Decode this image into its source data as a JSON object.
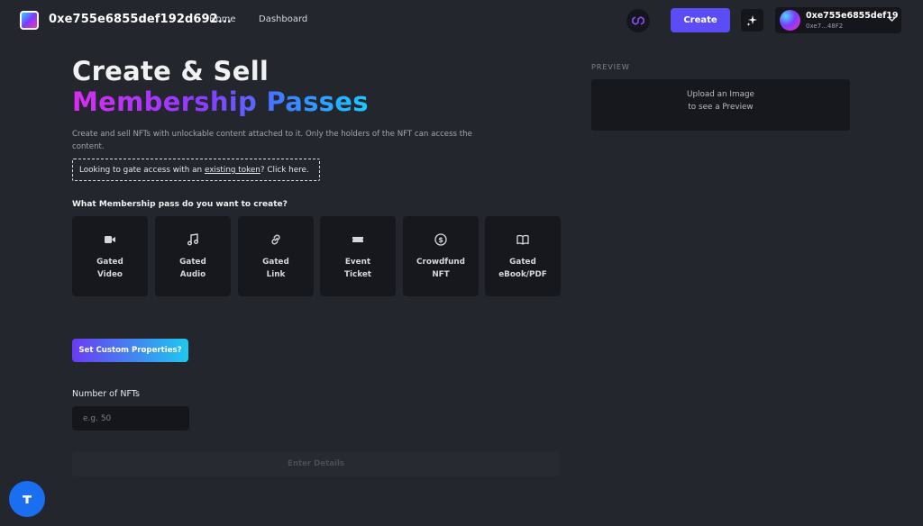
{
  "nav": {
    "brand": "0xe755e6855def192d692...",
    "links": [
      "Home",
      "Dashboard"
    ],
    "create_label": "Create",
    "account_name": "0xe755e6855def19",
    "account_short": "0xe7...48F2"
  },
  "hero": {
    "title_line1": "Create & Sell",
    "title_line2": "Membership Passes",
    "description": "Create and sell NFTs with unlockable content attached to it. Only the holders of the NFT can access the content.",
    "gate_prefix": "Looking to gate access with an ",
    "gate_link": "existing token",
    "gate_suffix": "? Click here."
  },
  "form": {
    "question": "What Membership pass do you want to create?",
    "cards": [
      {
        "line1": "Gated",
        "line2": "Video",
        "icon": "video-icon"
      },
      {
        "line1": "Gated",
        "line2": "Audio",
        "icon": "music-icon"
      },
      {
        "line1": "Gated",
        "line2": "Link",
        "icon": "link-icon"
      },
      {
        "line1": "Event",
        "line2": "Ticket",
        "icon": "ticket-icon"
      },
      {
        "line1": "Crowdfund",
        "line2": "NFT",
        "icon": "dollar-icon"
      },
      {
        "line1": "Gated",
        "line2": "eBook/PDF",
        "icon": "book-icon"
      }
    ],
    "custom_props_label": "Set Custom Properties?",
    "nft_count_label": "Number of NFTs",
    "nft_count_placeholder": "e.g. 50",
    "nft_count_value": "",
    "submit_label": "Enter Details"
  },
  "preview": {
    "label": "PREVIEW",
    "line1": "Upload an Image",
    "line2": "to see a Preview"
  },
  "colors": {
    "background": "#24262e",
    "panel": "#17181d",
    "accent": "#5b4cf5",
    "chat": "#1a6ff0"
  }
}
